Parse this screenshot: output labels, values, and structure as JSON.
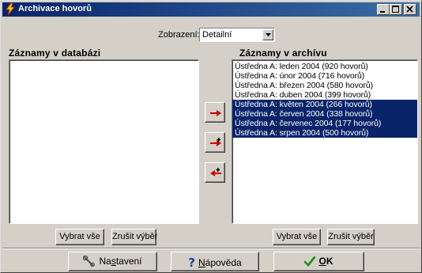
{
  "window": {
    "title": "Archivace hovorů"
  },
  "view": {
    "label": "Zobrazení:",
    "selected": "Detailní"
  },
  "left_panel": {
    "heading": "Záznamy v databázi",
    "items": []
  },
  "right_panel": {
    "heading": "Záznamy v archívu",
    "items": [
      {
        "label": "Ústředna A: leden 2004 (920 hovorů)",
        "selected": false
      },
      {
        "label": "Ústředna A: únor 2004 (716 hovorů)",
        "selected": false
      },
      {
        "label": "Ústředna A: březen 2004 (580 hovorů)",
        "selected": false
      },
      {
        "label": "Ústředna A: duben 2004 (399 hovorů)",
        "selected": false
      },
      {
        "label": "Ústředna A: květen 2004 (266 hovorů)",
        "selected": true
      },
      {
        "label": "Ústředna A: červen 2004 (338 hovorů)",
        "selected": true
      },
      {
        "label": "Ústředna A: červenec 2004 (177 hovorů)",
        "selected": true
      },
      {
        "label": "Ústředna A: srpen 2004 (500 hovorů)",
        "selected": true
      }
    ]
  },
  "selection_buttons": {
    "select_all": "Vybrat vše",
    "clear_selection": "Zrušit výběr"
  },
  "move_buttons": {
    "move_selected_icon": "arrow-right-icon",
    "move_all_icon": "arrow-right-plus-icon",
    "move_back_icon": "arrow-left-plus-icon"
  },
  "footer": {
    "settings_label": "Nastavení",
    "help_label": "Nápověda",
    "ok_label": "OK"
  },
  "colors": {
    "title_bar": "#0a246a",
    "selection": "#0a246a",
    "arrow": "#cc0000"
  }
}
